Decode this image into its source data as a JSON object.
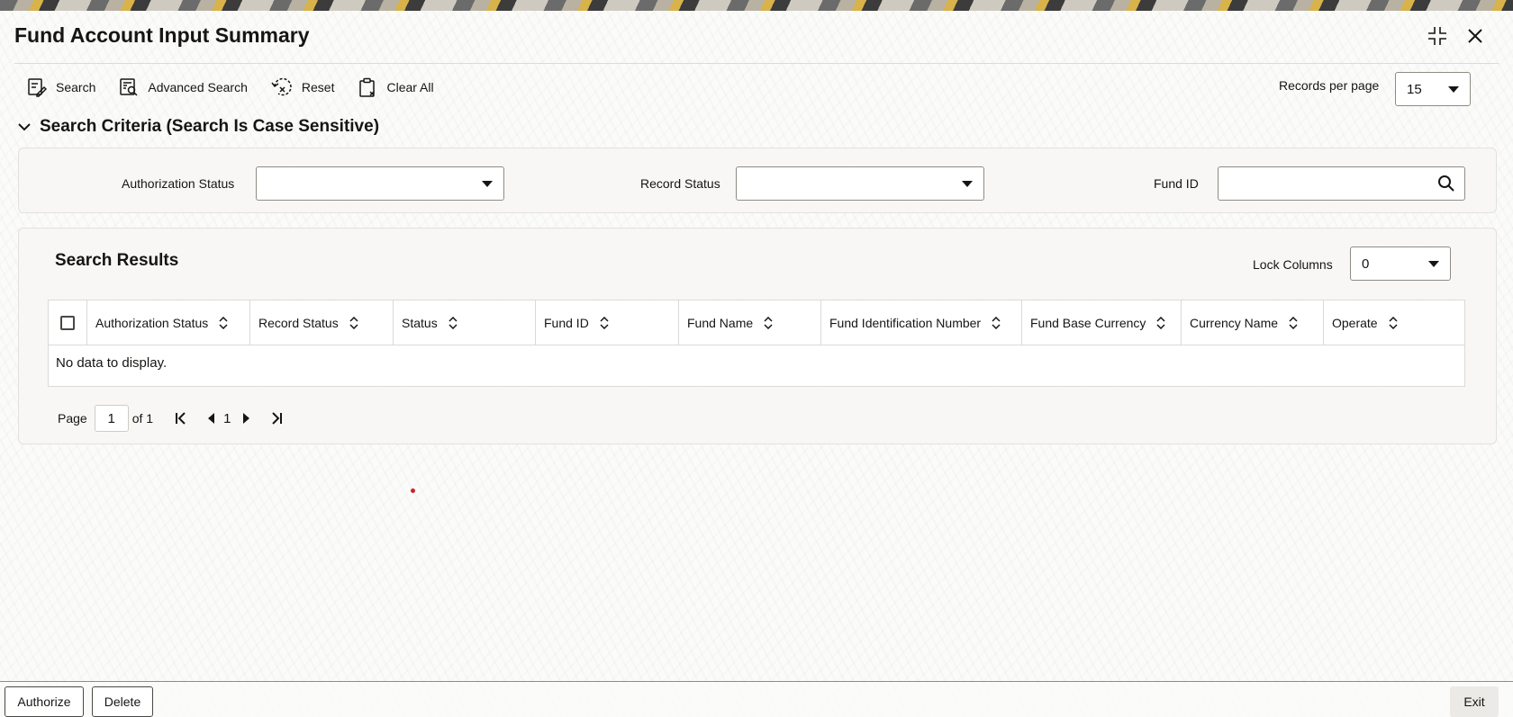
{
  "window": {
    "title": "Fund Account Input Summary"
  },
  "toolbar": {
    "search_label": "Search",
    "advanced_search_label": "Advanced Search",
    "reset_label": "Reset",
    "clear_all_label": "Clear All",
    "records_per_page_label": "Records per page",
    "records_per_page_value": "15"
  },
  "criteria": {
    "heading": "Search Criteria (Search Is Case Sensitive)",
    "authorization_status_label": "Authorization Status",
    "authorization_status_value": "",
    "record_status_label": "Record Status",
    "record_status_value": "",
    "fund_id_label": "Fund ID",
    "fund_id_value": ""
  },
  "results": {
    "heading": "Search Results",
    "lock_columns_label": "Lock Columns",
    "lock_columns_value": "0",
    "columns": [
      "Authorization Status",
      "Record Status",
      "Status",
      "Fund ID",
      "Fund Name",
      "Fund Identification Number",
      "Fund Base Currency",
      "Currency Name",
      "Operate"
    ],
    "empty_message": "No data to display."
  },
  "pager": {
    "page_label": "Page",
    "current_page": "1",
    "of_label": "of 1",
    "page_number": "1"
  },
  "footer": {
    "authorize_label": "Authorize",
    "delete_label": "Delete",
    "exit_label": "Exit"
  }
}
